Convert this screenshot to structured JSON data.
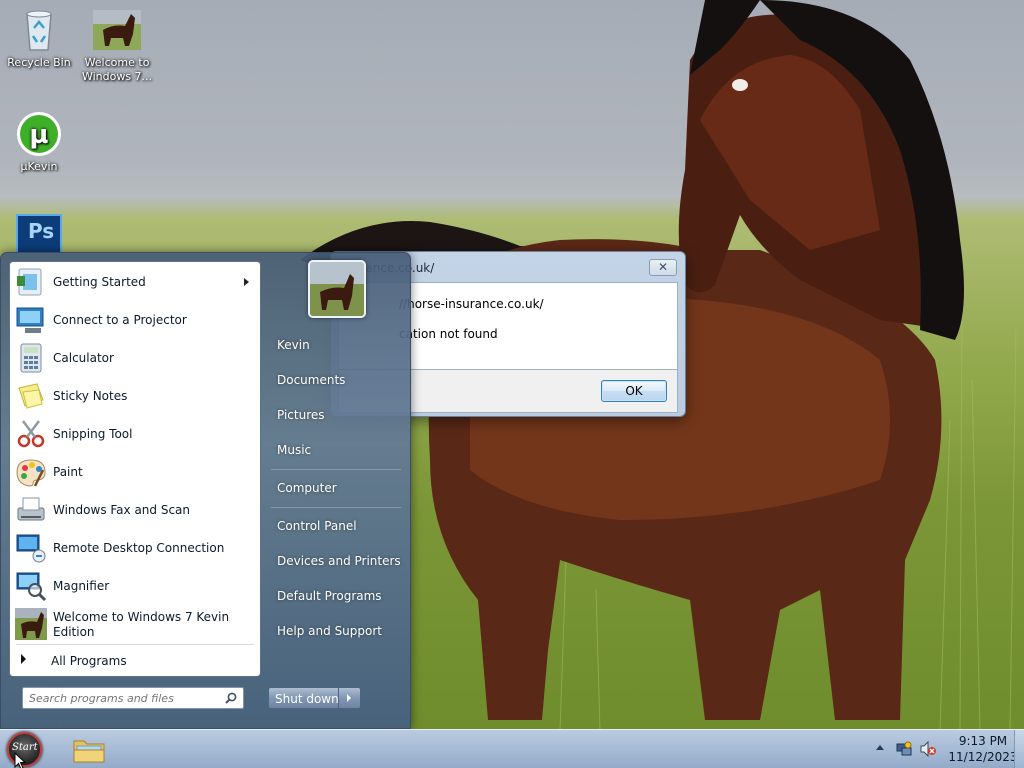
{
  "desktop": {
    "icons": [
      {
        "label": "Recycle Bin",
        "icon": "recycle-bin-icon"
      },
      {
        "label": "Welcome to Windows 7...",
        "icon": "horse-photo-icon"
      },
      {
        "label": "µKevin",
        "icon": "utorrent-icon"
      },
      {
        "label": "Ps",
        "icon": "photoshop-icon"
      }
    ]
  },
  "dialog": {
    "title": "nsurance.co.uk/",
    "line1": "//horse-insurance.co.uk/",
    "line2": "cation not found",
    "ok_label": "OK",
    "close_glyph": "✕"
  },
  "start_menu": {
    "programs": [
      {
        "label": "Getting Started",
        "icon": "getting-started-icon",
        "has_submenu": true
      },
      {
        "label": "Connect to a Projector",
        "icon": "projector-icon"
      },
      {
        "label": "Calculator",
        "icon": "calculator-icon"
      },
      {
        "label": "Sticky Notes",
        "icon": "sticky-notes-icon"
      },
      {
        "label": "Snipping Tool",
        "icon": "scissors-icon"
      },
      {
        "label": "Paint",
        "icon": "paint-palette-icon"
      },
      {
        "label": "Windows Fax and Scan",
        "icon": "fax-icon"
      },
      {
        "label": "Remote Desktop Connection",
        "icon": "remote-desktop-icon"
      },
      {
        "label": "Magnifier",
        "icon": "magnifier-icon"
      },
      {
        "label": "Welcome to Windows 7 Kevin",
        "label2": "Edition",
        "icon": "horse-photo-icon"
      }
    ],
    "all_programs": "All Programs",
    "search_placeholder": "Search programs and files",
    "right_items": [
      "Kevin",
      "Documents",
      "Pictures",
      "Music",
      "Computer",
      "Control Panel",
      "Devices and Printers",
      "Default Programs",
      "Help and Support"
    ],
    "shutdown_label": "Shut down"
  },
  "taskbar": {
    "start_label": "Start",
    "pinned": [
      {
        "icon": "windows-explorer-icon"
      }
    ],
    "clock_time": "9:13 PM",
    "clock_date": "11/12/2023"
  },
  "colors": {
    "taskbar": "#a9bdd6",
    "start_menu": "#627a96",
    "dialog_frame": "#b9cce2",
    "ok_button_border": "#3c7fb1"
  }
}
